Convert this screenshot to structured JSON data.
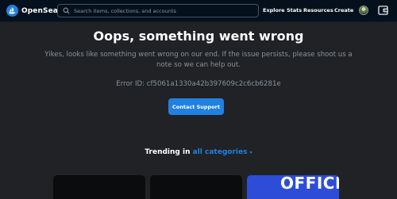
{
  "navbar": {
    "brand": "OpenSea",
    "search_placeholder": "Search items, collections, and accounts",
    "links": [
      "Explore",
      "Stats",
      "Resources",
      "Create"
    ]
  },
  "error": {
    "title": "Oops, something went wrong",
    "message": "Yikes, looks like something went wrong on our end. If the issue persists, please shoot us a note so we can help out.",
    "error_id": "Error ID: cf5061a1330a42b397609c2c6cb6281e",
    "contact_button": "Contact Support"
  },
  "trending": {
    "prefix": "Trending in",
    "link": "all categories",
    "chevron_icon": "chevron-down-icon"
  },
  "cards": [
    {
      "text": ""
    },
    {
      "text": ""
    },
    {
      "text": "OFFICE"
    }
  ],
  "colors": {
    "background": "#202225",
    "navbar": "#04111d",
    "accent": "#2081e2",
    "muted_text": "#8a939b"
  }
}
